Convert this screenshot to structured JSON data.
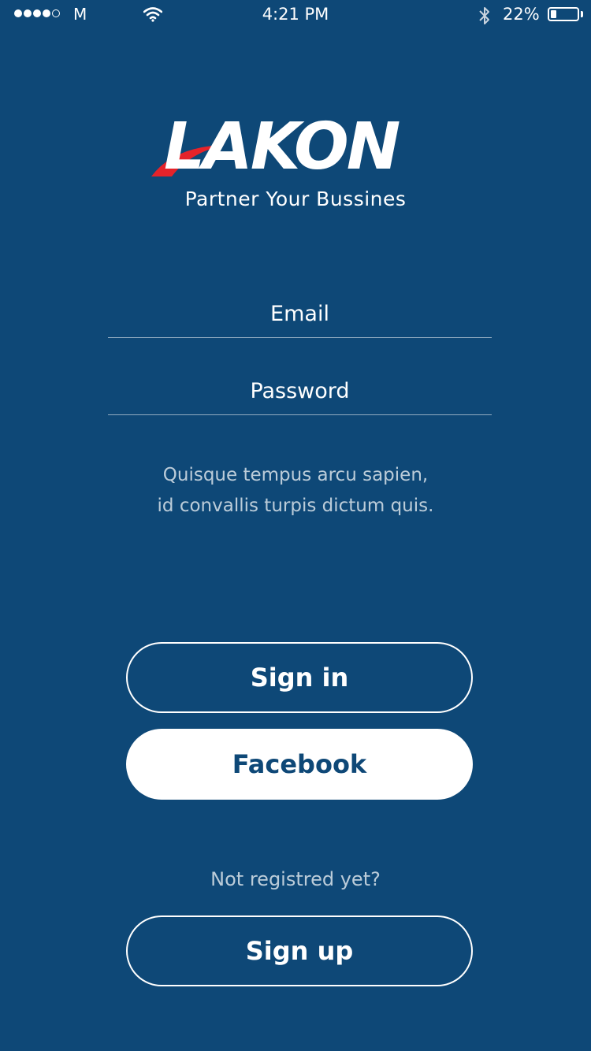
{
  "status_bar": {
    "carrier": "M",
    "time": "4:21 PM",
    "battery_percent_label": "22%",
    "battery_level": 0.22,
    "signal_bars_filled": 4,
    "signal_bars_total": 5
  },
  "brand": {
    "name": "LAKON",
    "tagline": "Partner Your Bussines",
    "accent_color": "#e5232a",
    "background_color": "#0e4877"
  },
  "form": {
    "email_placeholder": "Email",
    "password_placeholder": "Password",
    "helper_line_1": "Quisque tempus arcu sapien,",
    "helper_line_2": "id convallis turpis dictum quis."
  },
  "actions": {
    "sign_in_label": "Sign in",
    "facebook_label": "Facebook",
    "not_registered_text": "Not registred yet?",
    "sign_up_label": "Sign up"
  },
  "icons": {
    "wifi": "wifi-icon",
    "bluetooth": "bluetooth-icon",
    "battery": "battery-icon"
  }
}
